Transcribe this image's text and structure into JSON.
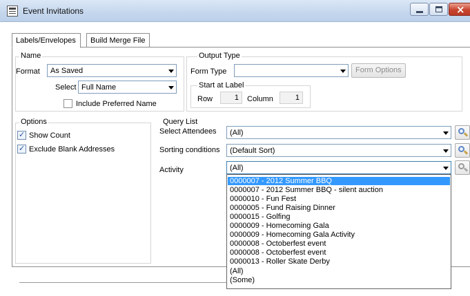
{
  "window": {
    "title": "Event Invitations",
    "min_icon": "minimize-icon",
    "max_icon": "maximize-icon",
    "close_icon": "close-icon"
  },
  "tabs": [
    {
      "label": "Labels/Envelopes",
      "active": true
    },
    {
      "label": "Build Merge File",
      "active": false
    }
  ],
  "name_group": {
    "legend": "Name",
    "format_label": "Format",
    "format_value": "As Saved",
    "select_label": "Select",
    "select_value": "Full Name",
    "include_preferred_label": "Include Preferred Name",
    "include_preferred_checked": false
  },
  "output_group": {
    "legend": "Output Type",
    "form_type_label": "Form Type",
    "form_type_value": "",
    "form_options_label": "Form Options",
    "start_legend": "Start at Label",
    "row_label": "Row",
    "row_value": "1",
    "column_label": "Column",
    "column_value": "1"
  },
  "options_group": {
    "legend": "Options",
    "show_count_label": "Show Count",
    "show_count_checked": true,
    "exclude_blank_label": "Exclude Blank Addresses",
    "exclude_blank_checked": true
  },
  "query_group": {
    "legend": "Query List",
    "attendees_label": "Select Attendees",
    "attendees_value": "(All)",
    "sorting_label": "Sorting conditions",
    "sorting_value": "(Default Sort)",
    "activity_label": "Activity",
    "activity_value": "(All)"
  },
  "activity_dropdown": {
    "selected_index": 0,
    "options": [
      "0000007 - 2012 Summer BBQ",
      "0000007 - 2012 Summer BBQ - silent auction",
      "0000010 - Fun Fest",
      "0000005 - Fund Raising Dinner",
      "0000015 - Golfing",
      "0000009 - Homecoming Gala",
      "0000009 - Homecoming Gala Activity",
      "0000008 - Octoberfest event",
      "0000008 - Octoberfest event",
      "0000013 - Roller Skate Derby",
      "(All)",
      "(Some)"
    ]
  },
  "colors": {
    "selection": "#3399ff",
    "close_button": "#c9452f",
    "titlebar": "#c5d7ee"
  }
}
